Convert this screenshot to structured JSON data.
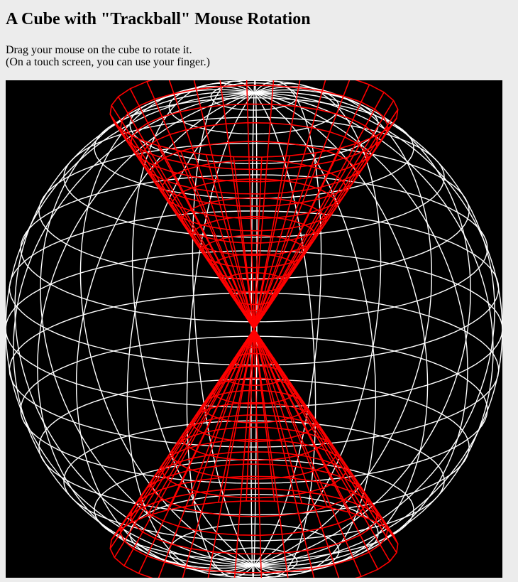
{
  "page": {
    "title": "A Cube with \"Trackball\" Mouse Rotation",
    "instructions": [
      "Drag your mouse on the cube to rotate it.",
      "(On a touch screen, you can use your finger.)"
    ]
  },
  "scene": {
    "background": "#000000",
    "sphere_color": "#ffffff",
    "surface_color": "#ff0000"
  }
}
